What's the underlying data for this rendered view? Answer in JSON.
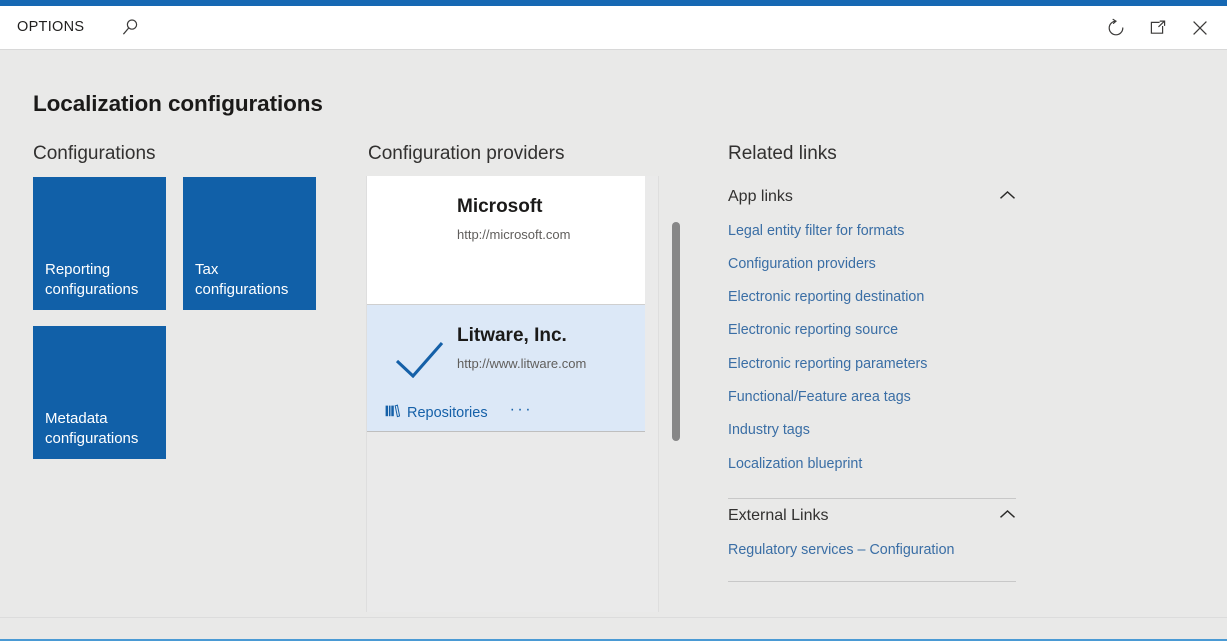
{
  "titlebar": {
    "options_label": "OPTIONS",
    "search_icon": "search-icon",
    "refresh_icon": "refresh-icon",
    "popout_icon": "popout-window-icon",
    "close_icon": "close-icon"
  },
  "page": {
    "title": "Localization configurations"
  },
  "configurations": {
    "heading": "Configurations",
    "tiles": [
      {
        "label": "Reporting\nconfigurations"
      },
      {
        "label": "Tax\nconfigurations"
      },
      {
        "label": "Metadata\nconfigurations"
      }
    ]
  },
  "providers": {
    "heading": "Configuration providers",
    "cards": [
      {
        "name": "Microsoft",
        "url": "http://microsoft.com",
        "selected": false
      },
      {
        "name": "Litware, Inc.",
        "url": "http://www.litware.com",
        "selected": true,
        "check_icon": "checkmark-icon",
        "repositories_label": "Repositories",
        "repositories_icon": "books-repository-icon",
        "overflow_label": "···"
      }
    ]
  },
  "related_links": {
    "heading": "Related links",
    "groups": [
      {
        "title": "App links",
        "chevron_icon": "chevron-up-icon",
        "items": [
          "Legal entity filter for formats",
          "Configuration providers",
          "Electronic reporting destination",
          "Electronic reporting source",
          "Electronic reporting parameters",
          "Functional/Feature area tags",
          "Industry tags",
          "Localization blueprint"
        ]
      },
      {
        "title": "External Links",
        "chevron_icon": "chevron-up-icon",
        "items": [
          "Regulatory services – Configuration"
        ]
      }
    ]
  },
  "colors": {
    "accent_blue": "#1668b3",
    "tile_blue": "#1160a8",
    "selected_card": "#dce8f7",
    "link_blue": "#3a6ea5",
    "page_background": "#e9e9e8",
    "status_underline": "#4a9ad4"
  }
}
